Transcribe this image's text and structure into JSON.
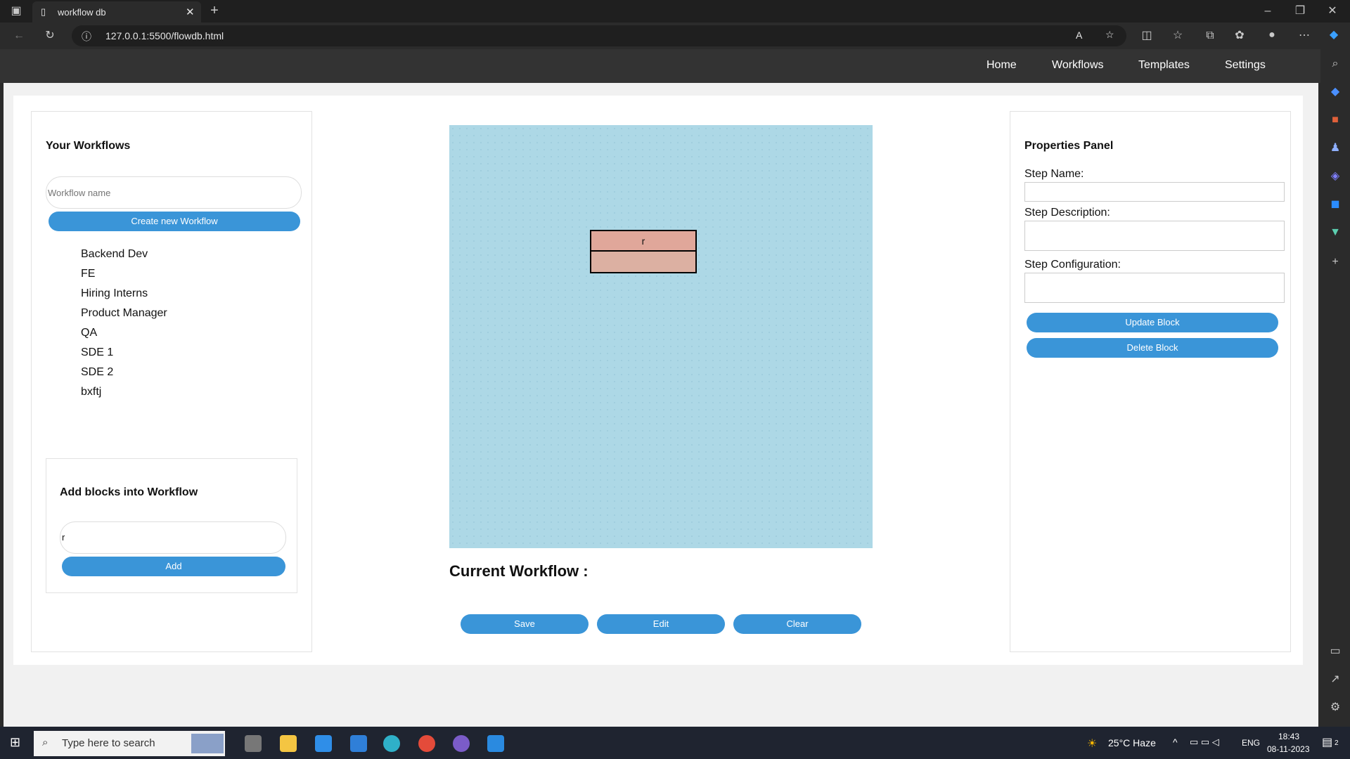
{
  "browser": {
    "tab_title": "workflow db",
    "url": "127.0.0.1:5500/flowdb.html"
  },
  "nav": {
    "links": [
      "Home",
      "Workflows",
      "Templates",
      "Settings"
    ]
  },
  "left_panel": {
    "title": "Your Workflows",
    "name_placeholder": "Workflow name",
    "create_button": "Create new Workflow",
    "workflows": [
      "Backend Dev",
      "FE",
      "Hiring Interns",
      "Product Manager",
      "QA",
      "SDE 1",
      "SDE 2",
      "bxftj"
    ]
  },
  "add_blocks": {
    "title": "Add blocks into Workflow",
    "input_value": "r",
    "add_button": "Add"
  },
  "canvas": {
    "block_label": "r"
  },
  "center": {
    "current_workflow_label": "Current Workflow :",
    "save_button": "Save",
    "edit_button": "Edit",
    "clear_button": "Clear"
  },
  "properties": {
    "title": "Properties Panel",
    "step_name_label": "Step Name:",
    "step_description_label": "Step Description:",
    "step_configuration_label": "Step Configuration:",
    "update_button": "Update Block",
    "delete_button": "Delete Block"
  },
  "taskbar": {
    "search_placeholder": "Type here to search",
    "weather": "25°C  Haze",
    "language": "ENG",
    "time": "18:43",
    "date": "08-11-2023",
    "notifications": "2"
  },
  "colors": {
    "accent": "#3a95d8",
    "canvas": "#add8e6",
    "block": "#e0a79a",
    "navbar": "#333333"
  }
}
